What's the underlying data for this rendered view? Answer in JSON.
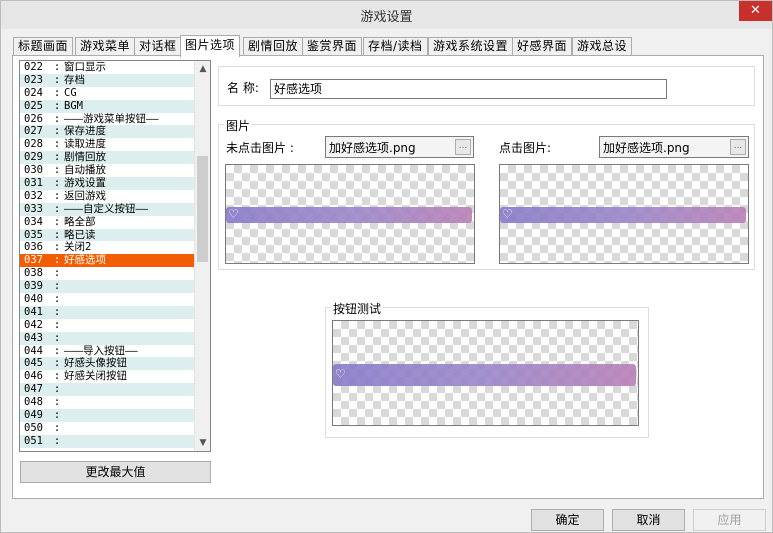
{
  "window": {
    "title": "游戏设置",
    "close_glyph": "✕"
  },
  "tabs": [
    {
      "label": "标题画面"
    },
    {
      "label": "游戏菜单"
    },
    {
      "label": "对话框"
    },
    {
      "label": "图片选项"
    },
    {
      "label": "剧情回放"
    },
    {
      "label": "鉴赏界面"
    },
    {
      "label": "存档/读档"
    },
    {
      "label": "游戏系统设置"
    },
    {
      "label": "好感界面"
    },
    {
      "label": "游戏总设"
    }
  ],
  "active_tab": "图片选项",
  "list": {
    "selected": "037",
    "rows": [
      {
        "num": "022",
        "text": "窗口显示"
      },
      {
        "num": "023",
        "text": "存档"
      },
      {
        "num": "024",
        "text": "CG"
      },
      {
        "num": "025",
        "text": "BGM"
      },
      {
        "num": "026",
        "text": "―――游戏菜单按钮――"
      },
      {
        "num": "027",
        "text": "保存进度"
      },
      {
        "num": "028",
        "text": "读取进度"
      },
      {
        "num": "029",
        "text": "剧情回放"
      },
      {
        "num": "030",
        "text": "自动播放"
      },
      {
        "num": "031",
        "text": "游戏设置"
      },
      {
        "num": "032",
        "text": "返回游戏"
      },
      {
        "num": "033",
        "text": "―――自定义按钮――"
      },
      {
        "num": "034",
        "text": "略全部"
      },
      {
        "num": "035",
        "text": "略已读"
      },
      {
        "num": "036",
        "text": "关闭2"
      },
      {
        "num": "037",
        "text": "好感选项"
      },
      {
        "num": "038",
        "text": ""
      },
      {
        "num": "039",
        "text": ""
      },
      {
        "num": "040",
        "text": ""
      },
      {
        "num": "041",
        "text": ""
      },
      {
        "num": "042",
        "text": ""
      },
      {
        "num": "043",
        "text": ""
      },
      {
        "num": "044",
        "text": "―――导入按钮――"
      },
      {
        "num": "045",
        "text": "好感头像按钮"
      },
      {
        "num": "046",
        "text": "好感关闭按钮"
      },
      {
        "num": "047",
        "text": ""
      },
      {
        "num": "048",
        "text": ""
      },
      {
        "num": "049",
        "text": ""
      },
      {
        "num": "050",
        "text": ""
      },
      {
        "num": "051",
        "text": ""
      }
    ],
    "separator": ":",
    "scroll_up": "▲",
    "scroll_down": "▼"
  },
  "change_max_button": "更改最大值",
  "name_field": {
    "label": "名 称:",
    "value": "好感选项"
  },
  "image_group": {
    "title": "图片",
    "normal_label": "未点击图片 :",
    "normal_file": "加好感选项.png",
    "clicked_label": "点击图片:",
    "clicked_file": "加好感选项.png",
    "browse_glyph": "..."
  },
  "test_group": {
    "title": "按钮测试"
  },
  "heart_glyph": "♡",
  "footer": {
    "ok": "确定",
    "cancel": "取消",
    "apply": "应用"
  }
}
